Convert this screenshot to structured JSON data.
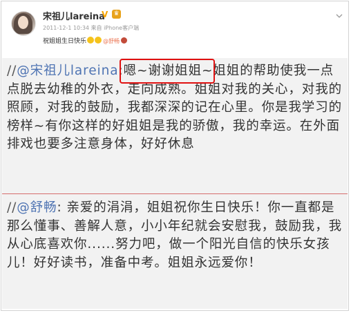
{
  "post": {
    "nickname": "宋祖儿lareina",
    "verified_mark": "V",
    "medal_glyph": "♛",
    "meta": "2011-12-1 10:34 来自 iPhone客户端",
    "short_text": "祝姐姐生日快乐",
    "short_mention": "@舒畅",
    "chevron_icon": "chevron-down-icon"
  },
  "repost": {
    "slash": "//",
    "mention": "@宋祖儿lareina",
    "text": ":嗯~谢谢姐姐~姐姐的帮助使我一点点脱去幼稚的外衣，走向成熟。姐姐对我的关心，对我的照顾，对我的鼓励，我都深深的记在心里。你是我学习的榜样~有你这样的好姐姐是我的骄傲，我的幸运。在外面排戏也要多注意身体，好好休息"
  },
  "original": {
    "slash": "//",
    "mention": "@舒畅",
    "text": ": 亲爱的涓涓，姐姐祝你生日快乐！你一直都是那么懂事、善解人意，小小年纪就会安慰我，鼓励我，我从心底喜欢你......努力吧，做一个阳光自信的快乐女孩儿！好好读书，准备中考。姐姐永远爱你！"
  },
  "colors": {
    "mention": "#4f74b3",
    "highlight_box": "#e01010",
    "divider": "#d66b6b",
    "verified": "#f7a500"
  }
}
